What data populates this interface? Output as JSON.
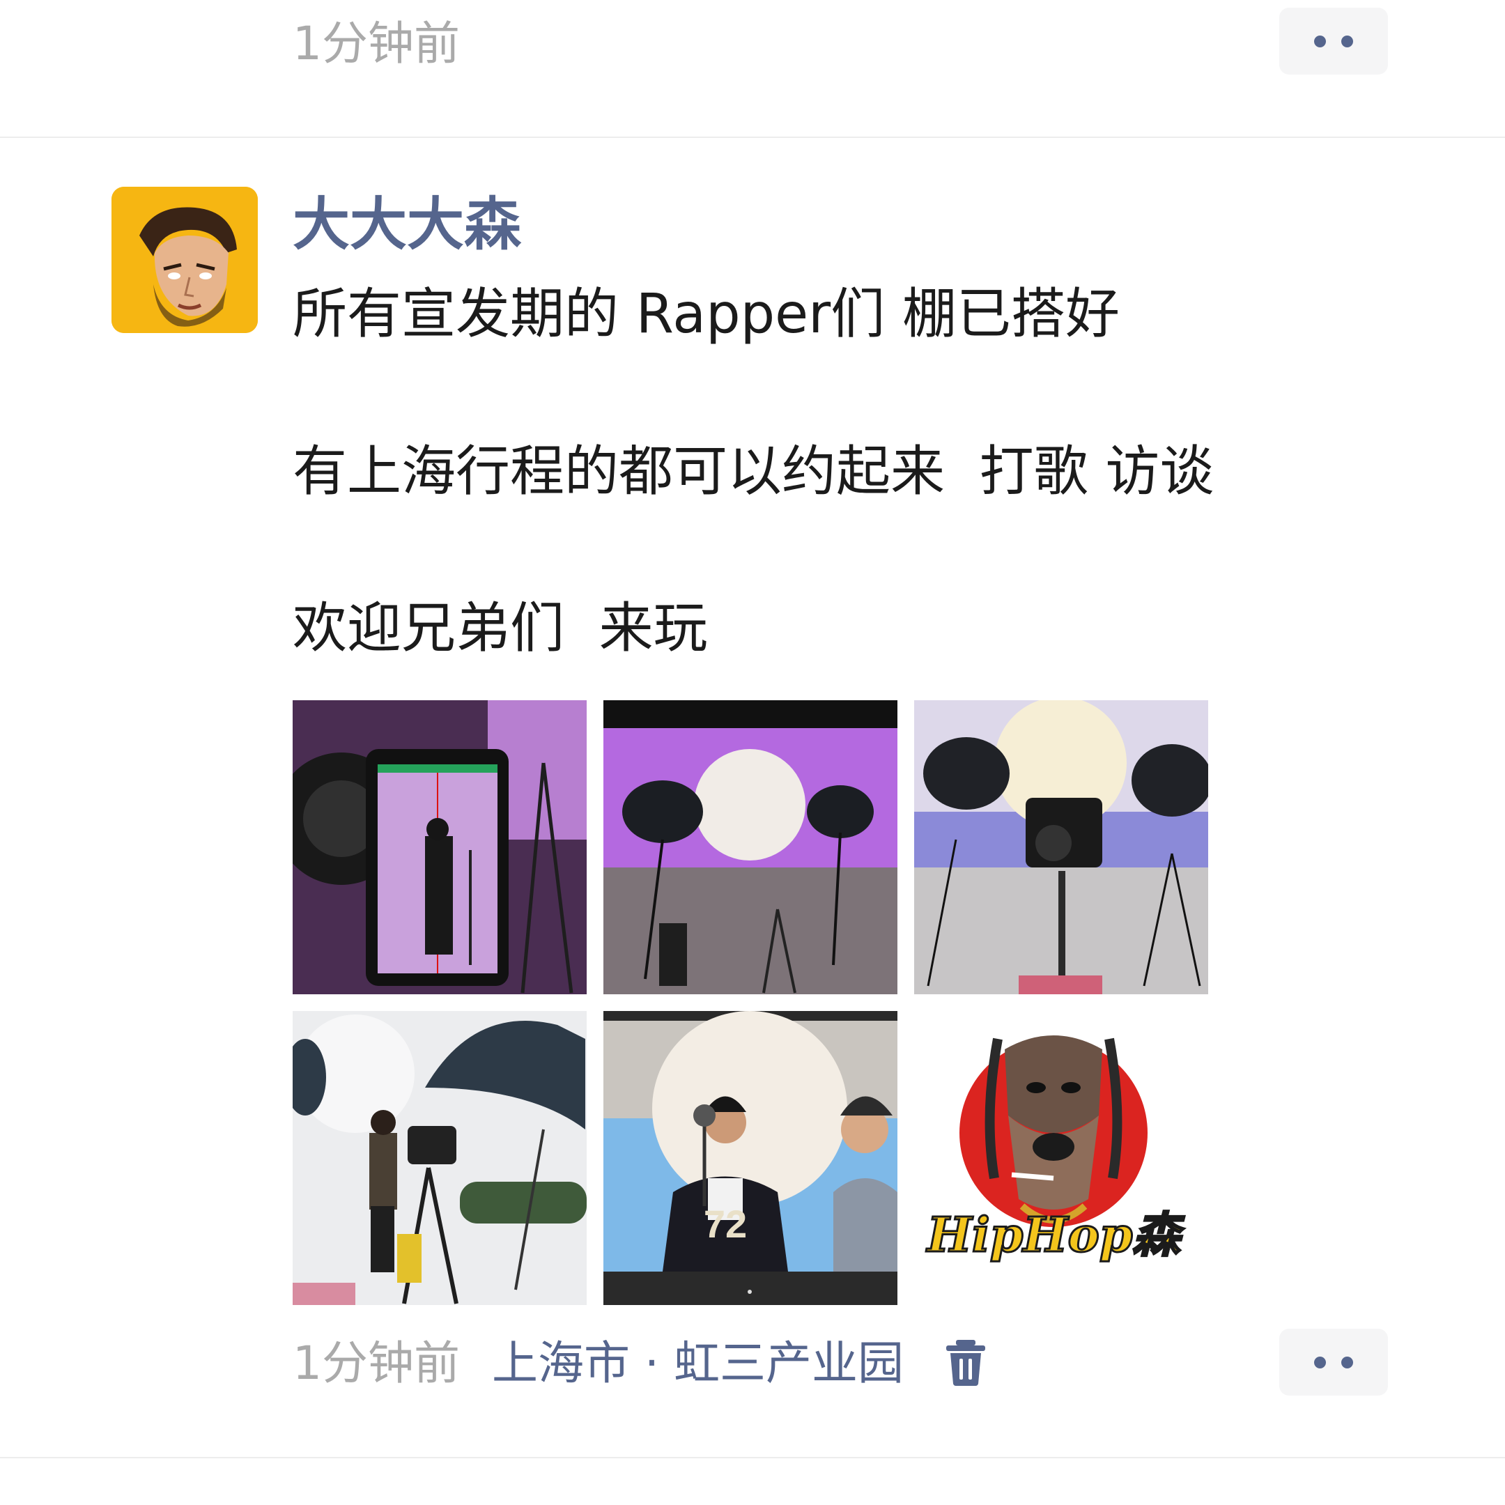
{
  "previous_post": {
    "time": "1分钟前"
  },
  "post": {
    "author": "大大大森",
    "lines": [
      "所有宣发期的 Rapper们 棚已搭好",
      "有上海行程的都可以约起来  打歌 访谈",
      "欢迎兄弟们  来玩"
    ],
    "time": "1分钟前",
    "location": "上海市 · 虹三产业园",
    "photos": [
      {
        "icon": "studio-monitor-photo",
        "jersey_number": ""
      },
      {
        "icon": "purple-studio-photo",
        "jersey_number": ""
      },
      {
        "icon": "studio-lights-photo",
        "jersey_number": ""
      },
      {
        "icon": "studio-shoot-photo",
        "jersey_number": ""
      },
      {
        "icon": "rapper-portrait-photo",
        "jersey_number": "72"
      },
      {
        "icon": "hiphop-dog-logo",
        "logo_text": "HipHop森"
      }
    ]
  },
  "icons": {
    "more": "more-dots-icon",
    "delete": "trash-icon"
  },
  "colors": {
    "link": "#55658d",
    "time": "#aaaaaa",
    "text": "#1b1b1b",
    "button_bg": "#f5f5f6",
    "avatar_bg": "#f6b612"
  }
}
